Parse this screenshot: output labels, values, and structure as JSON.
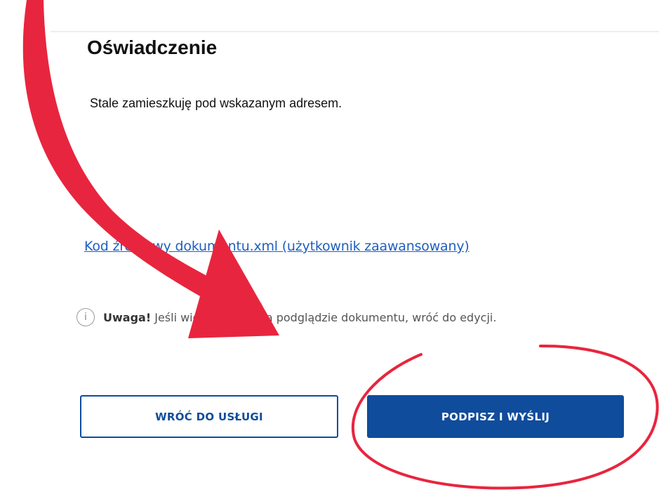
{
  "page": {
    "title": "Oświadczenie",
    "statement": "Stale zamieszkuję pod wskazanym adresem.",
    "source_link": "Kod źródłowy dokumentu.xml (użytkownik zaawansowany)"
  },
  "notice": {
    "icon": "info-icon",
    "strong": "Uwaga!",
    "text": "Jeśli widzisz błędy na podglądzie dokumentu, wróć do edycji."
  },
  "actions": {
    "back_label": "WRÓĆ DO USŁUGI",
    "sign_label": "PODPISZ I WYŚLIJ"
  },
  "annotation": {
    "color": "#e8253e",
    "shapes": [
      "arrow",
      "circle"
    ]
  },
  "colors": {
    "primary": "#0f4c9c",
    "link": "#1f5fbf"
  }
}
